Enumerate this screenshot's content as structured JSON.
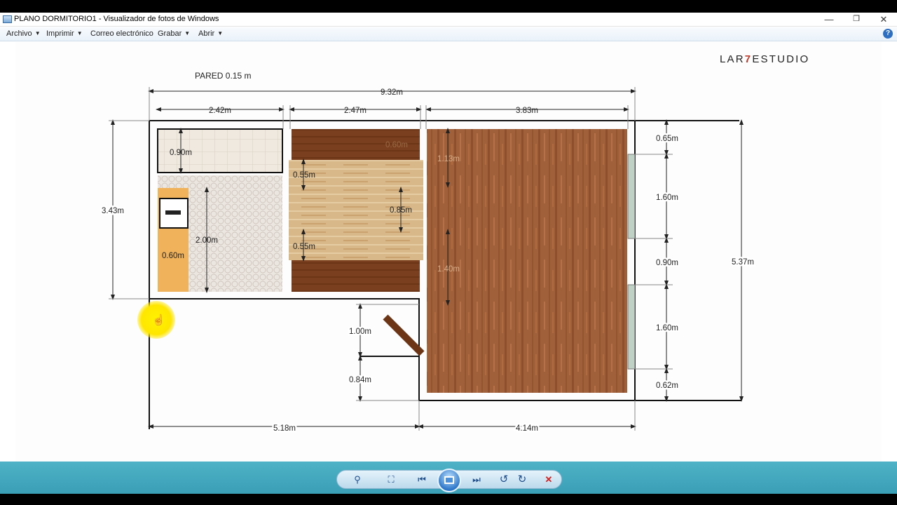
{
  "window": {
    "title": "PLANO DORMITORIO1 - Visualizador de fotos de Windows",
    "controls": {
      "minimize": "—",
      "maximize": "❐",
      "close": "✕"
    }
  },
  "menu": {
    "items": [
      "Archivo",
      "Imprimir",
      "Correo electrónico",
      "Grabar",
      "Abrir"
    ],
    "help": "?"
  },
  "plan": {
    "brand_prefix": "LAR",
    "brand_seven": "7",
    "brand_suffix": "ESTUDIO",
    "wall_label": "PARED 0.15 m",
    "dims": {
      "total_width": "9.32m",
      "w1": "2.42m",
      "w2": "2.47m",
      "w3": "3.83m",
      "left_height": "3.43m",
      "right_height": "5.37m",
      "bath_counter": "0.90m",
      "bath_tub": "2.00m",
      "bath_vanity": "0.60m",
      "closet_depth": "0.60m",
      "hall_upper": "0.55m",
      "hall_mid": "0.85m",
      "hall_lower": "0.55m",
      "room_upper": "1.13m",
      "room_lower": "1.40m",
      "r1": "0.65m",
      "r2": "1.60m",
      "r3": "0.90m",
      "r4": "1.60m",
      "r5": "0.62m",
      "door_width": "1.00m",
      "door_offset": "0.84m",
      "bottom_left": "5.18m",
      "bottom_right": "4.14m"
    }
  },
  "toolbar": {
    "zoom": "⚲",
    "fit": "⛶",
    "prev": "⏮",
    "next": "⏭",
    "rotate_left": "↺",
    "rotate_right": "↻",
    "delete": "✕"
  },
  "colors": {
    "toolbar": "#3fa7bd",
    "wood_dark": "#7a3f1e",
    "wood_room": "#a0603a",
    "wood_light": "#d9b98a",
    "tile": "#e4dcd6",
    "vanity": "#f0b25a",
    "delete": "#d32020"
  }
}
